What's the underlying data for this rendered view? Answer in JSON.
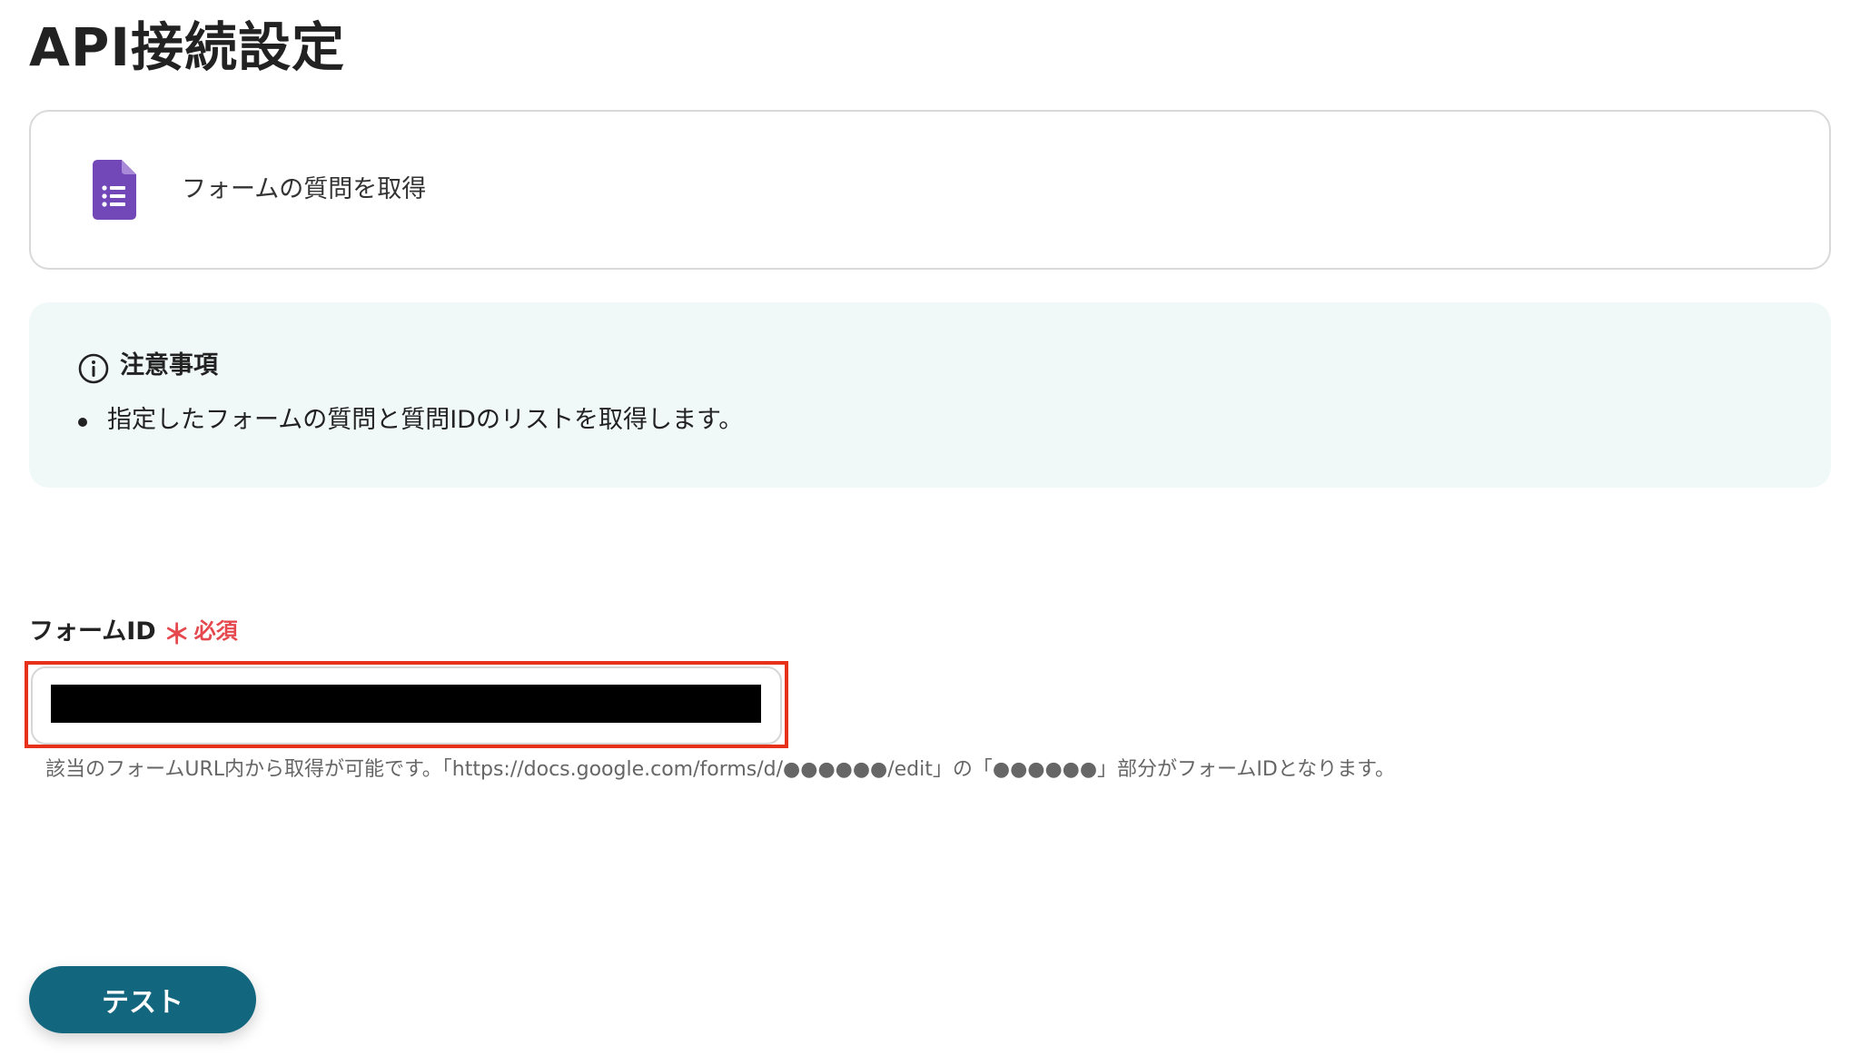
{
  "page": {
    "title": "API接続設定"
  },
  "action": {
    "icon": "google-forms-icon",
    "name": "フォームの質問を取得"
  },
  "notice": {
    "icon": "info-icon",
    "title": "注意事項",
    "items": [
      "指定したフォームの質問と質問IDのリストを取得します。"
    ]
  },
  "form_id_field": {
    "label": "フォームID",
    "required_mark": "＊",
    "required_text": "必須",
    "value": "",
    "help": "該当のフォームURL内から取得が可能です。「https://docs.google.com/forms/d/●●●●●●/edit」の「●●●●●●」部分がフォームIDとなります。"
  },
  "buttons": {
    "test_label": "テスト"
  },
  "colors": {
    "accent": "#12667e",
    "forms_purple": "#7248b9",
    "required_red": "#e5484d",
    "highlight_red": "#e8311a",
    "notice_bg": "#f1f9f8"
  }
}
